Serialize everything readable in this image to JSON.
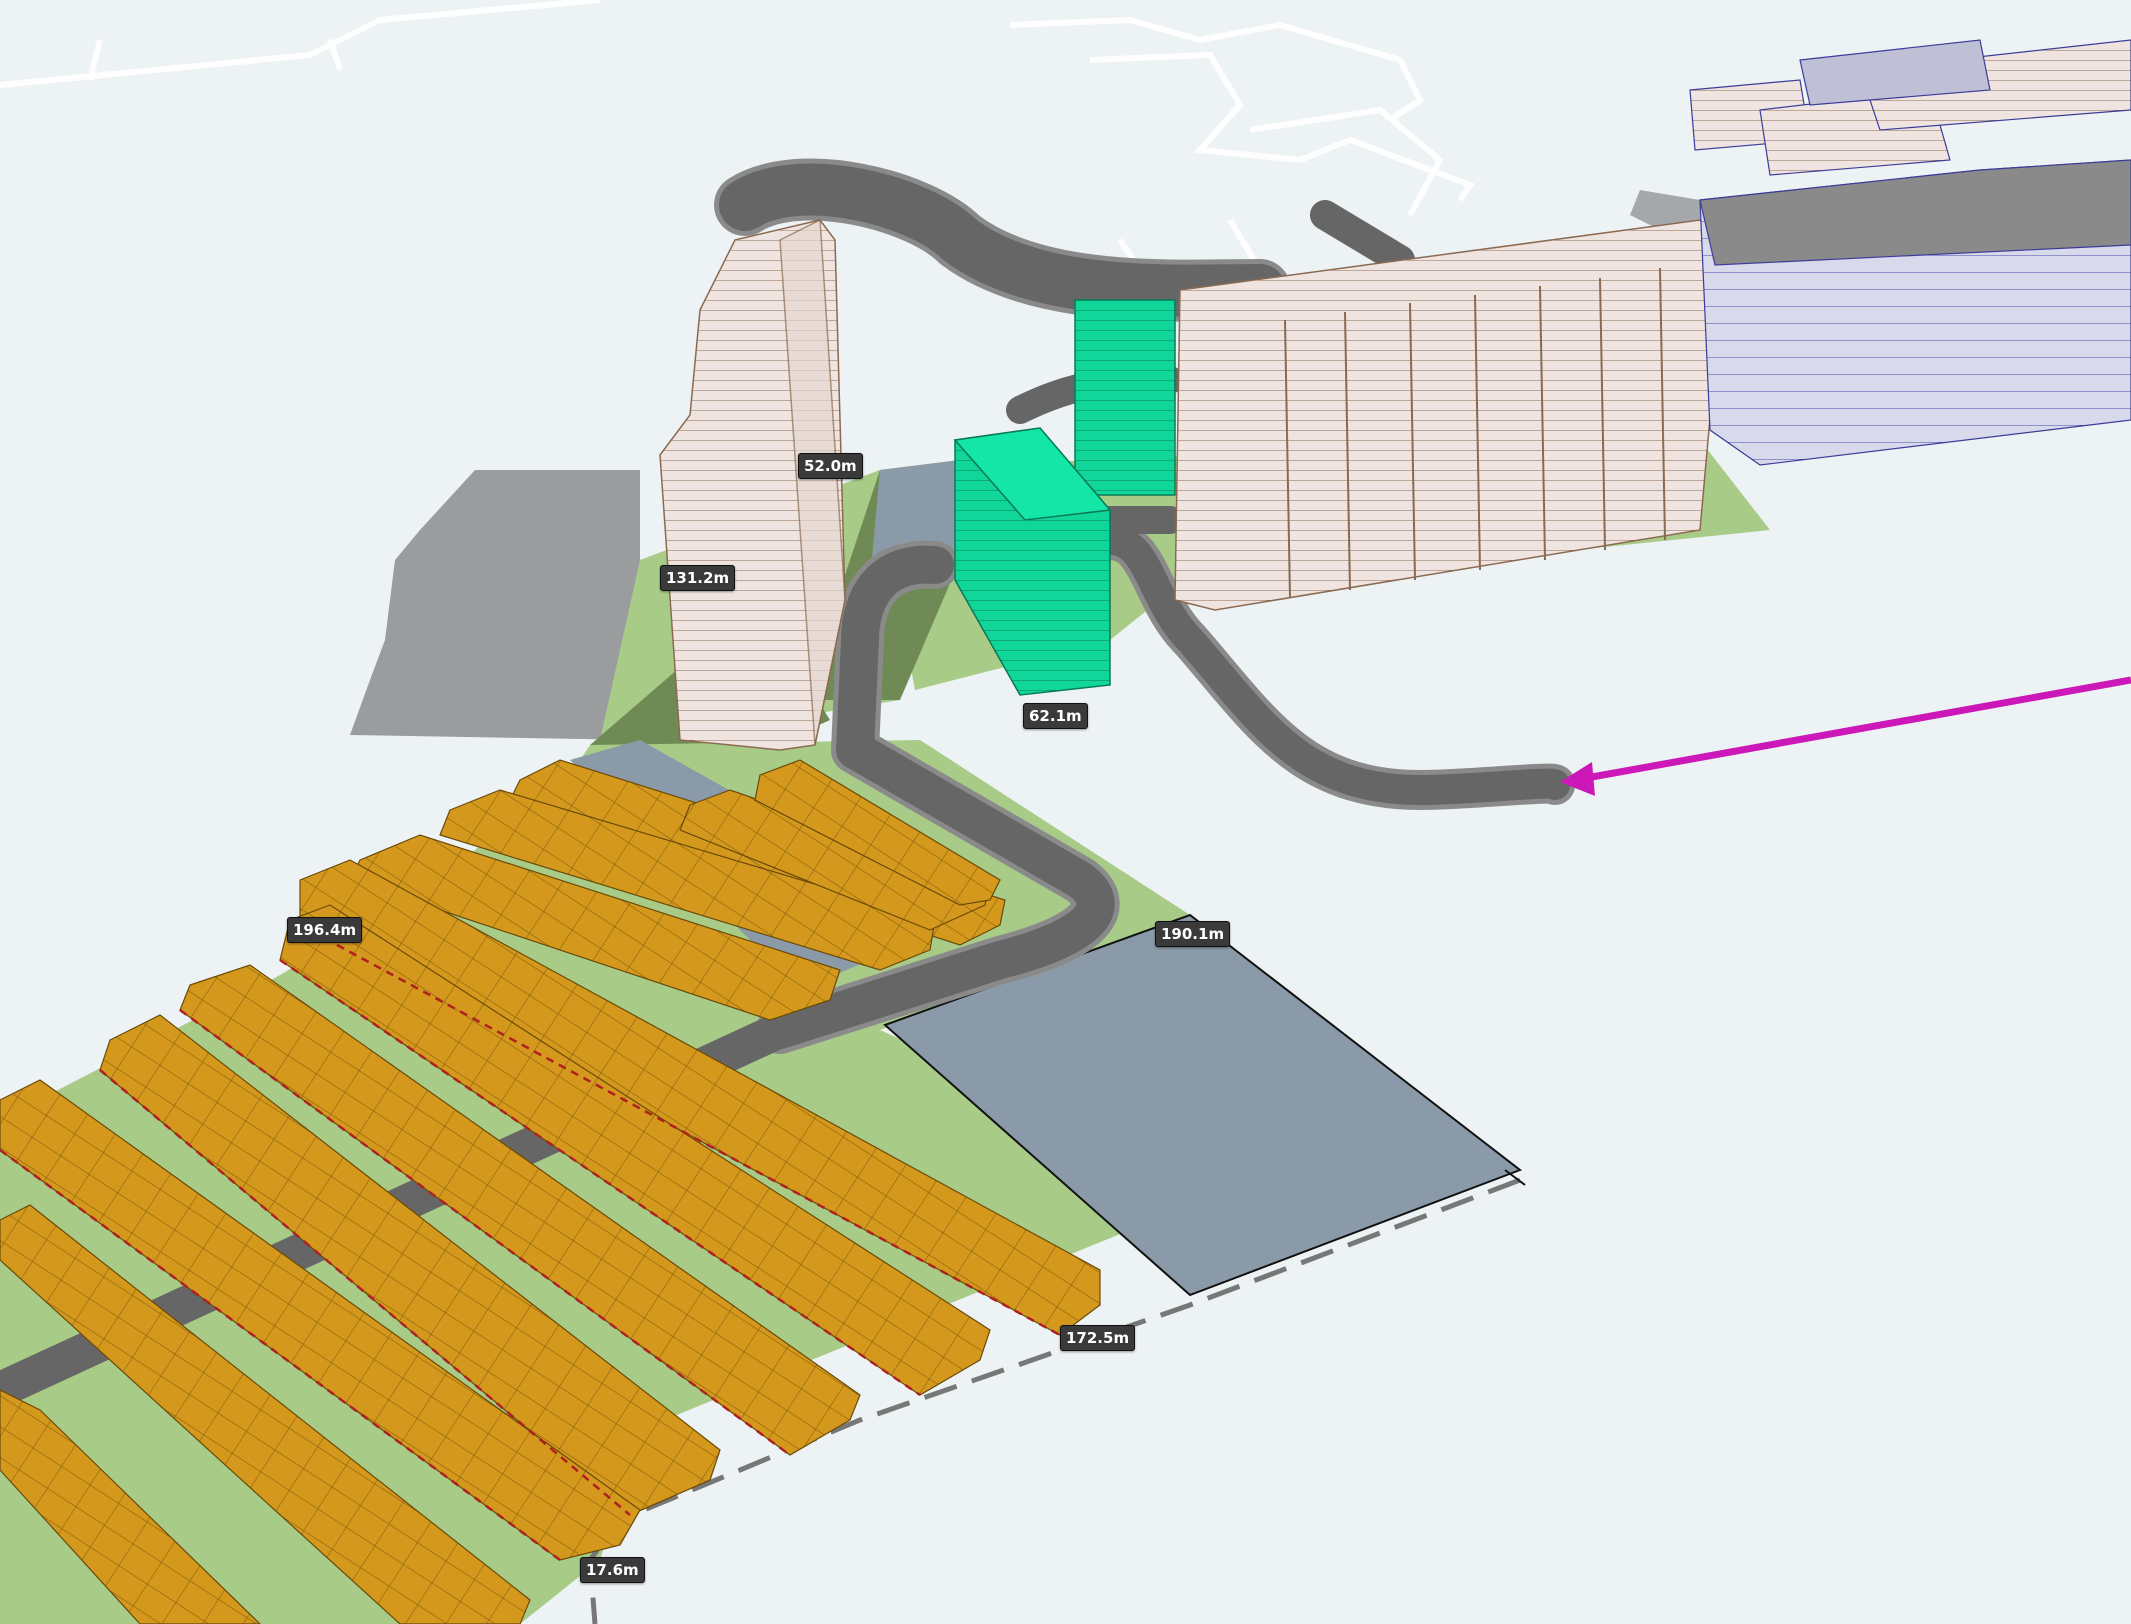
{
  "scene": {
    "dimension_labels": [
      {
        "id": "height-52",
        "text": "52.0m"
      },
      {
        "id": "height-131",
        "text": "131.2m"
      },
      {
        "id": "length-62",
        "text": "62.1m"
      },
      {
        "id": "length-196",
        "text": "196.4m"
      },
      {
        "id": "length-190",
        "text": "190.1m"
      },
      {
        "id": "length-172",
        "text": "172.5m"
      },
      {
        "id": "length-17",
        "text": "17.6m"
      }
    ],
    "colors": {
      "background": "#edf2f4",
      "road": "#666666",
      "green_space": "#a8cc88",
      "dark_green": "#6f8a55",
      "parking_lot": "#8b9aa8",
      "townhouse_block": "#d4991c",
      "residential_tower": "#efe4e0",
      "highlighted_building": "#11d69a",
      "commercial_building": "#d6d6e8",
      "shadow": "#9a9c9e",
      "arrow": "#cc18b8"
    }
  }
}
